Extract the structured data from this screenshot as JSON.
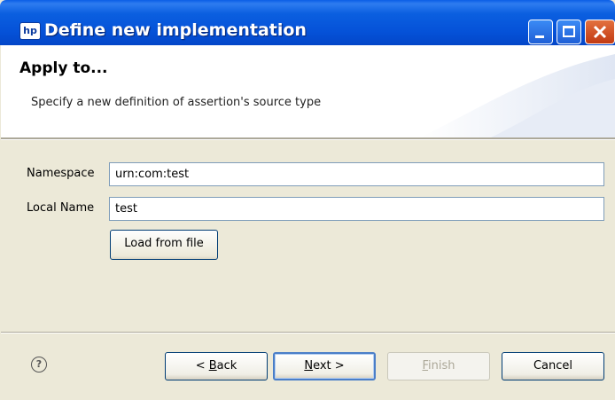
{
  "window": {
    "title": "Define new implementation",
    "icon_label": "hp",
    "controls": [
      "minimize-icon",
      "maximize-icon",
      "close-icon"
    ]
  },
  "header": {
    "title": "Apply to...",
    "description": "Specify a new definition of assertion's source type"
  },
  "form": {
    "namespace": {
      "label": "Namespace",
      "value": "urn:com:test"
    },
    "local_name": {
      "label": "Local Name",
      "value": "test"
    },
    "load_button": "Load from file"
  },
  "footer": {
    "help_icon": "?",
    "back": {
      "prefix": "< ",
      "mnemonic": "B",
      "rest": "ack"
    },
    "next": {
      "mnemonic": "N",
      "rest": "ext >"
    },
    "finish": {
      "mnemonic": "F",
      "rest": "inish",
      "enabled": false
    },
    "cancel": "Cancel"
  },
  "colors": {
    "titlebar": "#0552d8",
    "close_button": "#c23a12",
    "dialog_bg": "#ece9d8",
    "field_border": "#7f9db9"
  }
}
